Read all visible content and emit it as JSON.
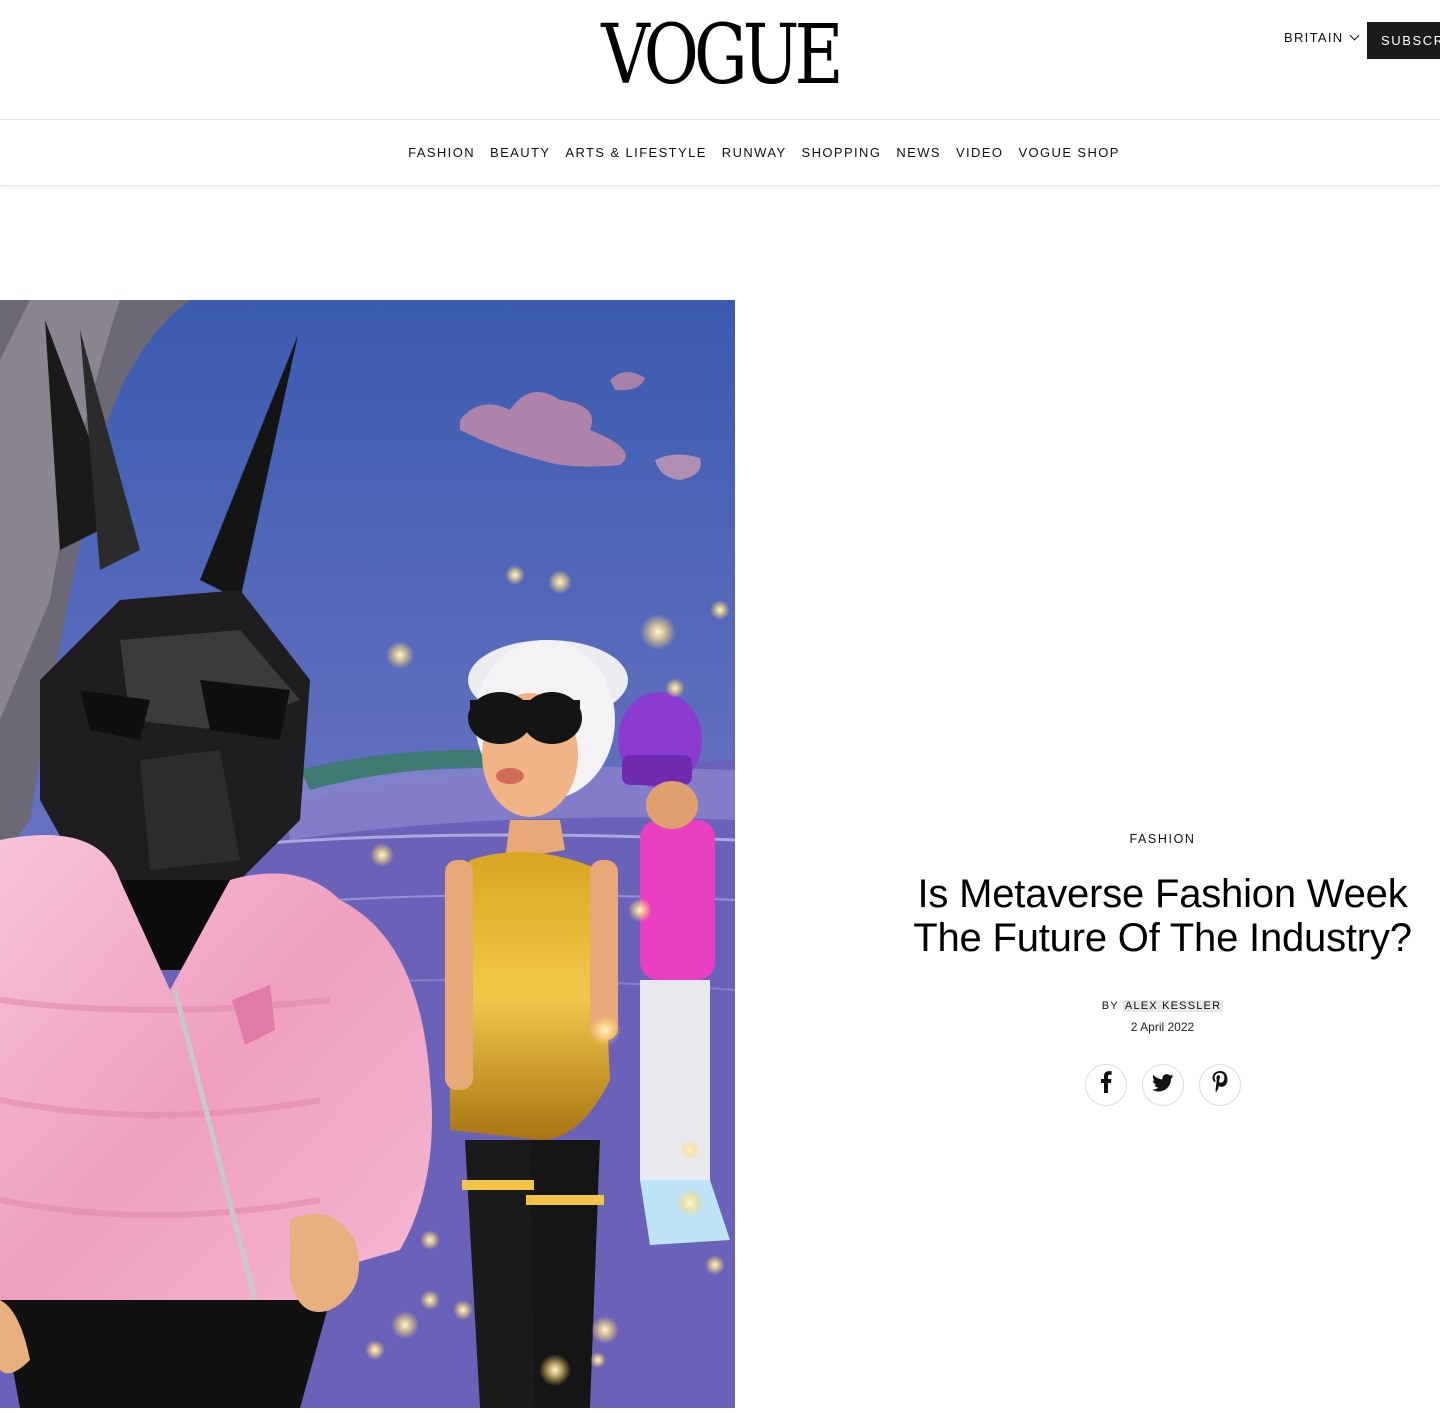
{
  "header": {
    "logo": "VOGUE",
    "edition": "BRITAIN",
    "subscribe_label": "SUBSCRIBE"
  },
  "nav": {
    "items": [
      "FASHION",
      "BEAUTY",
      "ARTS & LIFESTYLE",
      "RUNWAY",
      "SHOPPING",
      "NEWS",
      "VIDEO",
      "VOGUE SHOP"
    ]
  },
  "article": {
    "rubric": "FASHION",
    "headline": "Is Metaverse Fashion Week The Future Of The Industry?",
    "by_prefix": "BY",
    "author": "ALEX KESSLER",
    "date": "2 April 2022"
  },
  "social": {
    "facebook": "f",
    "twitter": "twitter-bird-icon",
    "pinterest": "P"
  },
  "colors": {
    "subscribe_bg": "#1b1b1b",
    "divider": "#e6e6e6",
    "jacket_pink": "#f2a9c8",
    "sky_blue": "#5667b5"
  }
}
